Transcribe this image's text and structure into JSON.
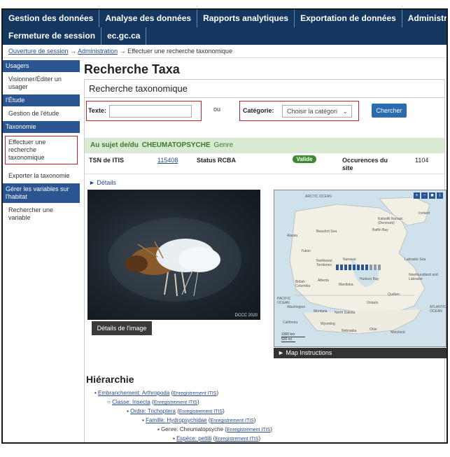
{
  "topnav": {
    "row1": [
      "Gestion des données",
      "Analyse des données",
      "Rapports analytiques",
      "Exportation de données",
      "Administration"
    ],
    "row2": [
      "Fermeture de session",
      "ec.gc.ca"
    ]
  },
  "breadcrumb": {
    "link1": "Ouverture de session",
    "sep": "→",
    "link2": "Administration",
    "current": "Effectuer une recherche taxonomique"
  },
  "sidebar": {
    "sections": [
      {
        "heading": "Usagers",
        "items": [
          "Visionner/Éditer un usager"
        ]
      },
      {
        "heading": "l'Étude",
        "items": [
          "Gestion de l'étude"
        ]
      },
      {
        "heading": "Taxonomie",
        "items": [
          "Effectuer une recherche taxonomique",
          "Exporter la taxonomie"
        ]
      },
      {
        "heading": "Gérer les variables sur l'habitat",
        "items": [
          "Rechercher une variable"
        ]
      }
    ]
  },
  "main": {
    "title": "Recherche Taxa",
    "panel_title": "Recherche taxonomique",
    "text_label": "Texte:",
    "text_value": "",
    "or_label": "ou",
    "category_label": "Catégorie:",
    "category_selected": "Choisir la catégori",
    "search_button": "Chercher",
    "about_prefix": "Au sujet de/du",
    "about_taxon": "CHEUMATOPSYCHE",
    "about_rank": "Genre",
    "tsn_label": "TSN de ITIS",
    "tsn_value": "115408",
    "status_label": "Status RCBA",
    "status_value": "Valide",
    "occ_label": "Occurences du site",
    "occ_value": "1104",
    "details_label": "► Détails",
    "photo_credit": "DCCC 2020",
    "image_button": "Détails de l'image",
    "map_instructions": "► Map Instructions",
    "hierarchy_title": "Hiérarchie",
    "hierarchy": [
      {
        "prefix": "Embranchement:",
        "name": "Arthropoda",
        "linked": true,
        "itis": "Enregistrement ITIS"
      },
      {
        "prefix": "Classe:",
        "name": "Insecta",
        "linked": true,
        "itis": "Enregistrement ITIS"
      },
      {
        "prefix": "Ordre:",
        "name": "Trichoptera",
        "linked": true,
        "itis": "Enregistrement ITIS"
      },
      {
        "prefix": "Famille:",
        "name": "Hydropsychidae",
        "linked": true,
        "itis": "Enregistrement ITIS"
      },
      {
        "prefix": "Genre:",
        "name": "Cheumatopsyche",
        "linked": false,
        "itis": "Enregistrement ITIS"
      },
      {
        "prefix": "Espèce:",
        "name": "pettiti",
        "linked": true,
        "itis": "Enregistrement ITIS"
      }
    ]
  },
  "map": {
    "labels": [
      "ARCTIC OCEAN",
      "Kalaallit Nunaat (Denmark)",
      "Iceland",
      "Alaska",
      "Beaufort Sea",
      "Baffin Bay",
      "Yukon",
      "Northwest Territories",
      "Nunavut",
      "Labrador Sea",
      "Hudson Bay",
      "British Columbia",
      "Alberta",
      "Manitoba",
      "Newfoundland and Labrador",
      "Québec",
      "Ontario",
      "PACIFIC OCEAN",
      "Washington",
      "Montana",
      "North Dakota",
      "ATLANTIC OCEAN",
      "Wyoming",
      "California",
      "Nebraska",
      "Ohio",
      "Maryland"
    ],
    "scale_km": "1000 km",
    "scale_mi": "500 mi",
    "controls": [
      "+",
      "−",
      "■",
      "i"
    ]
  },
  "colors": {
    "nav": "#14375f",
    "accent": "#2b6cb0",
    "valid": "#3c8a2e",
    "highlight": "#c0202a"
  }
}
